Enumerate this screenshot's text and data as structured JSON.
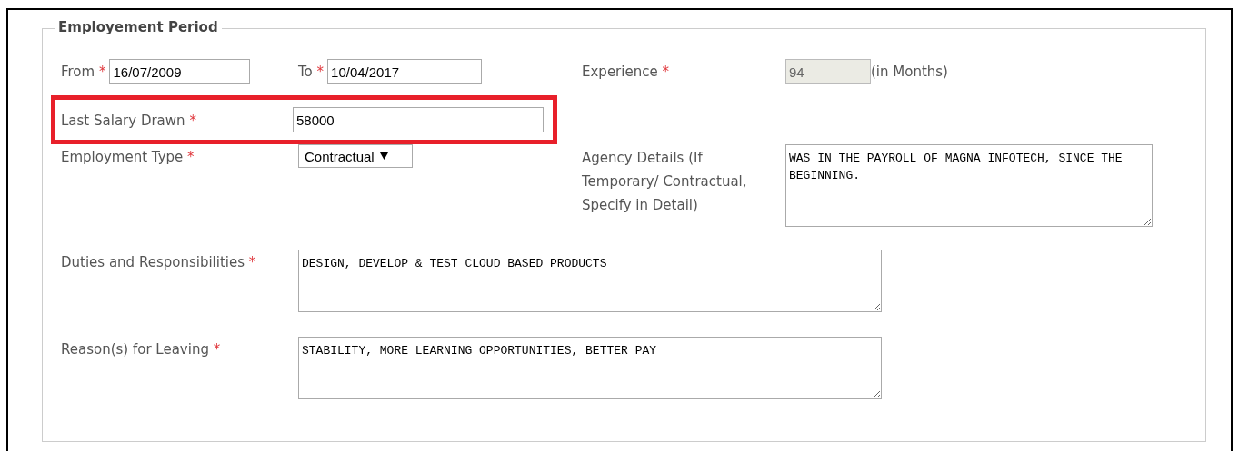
{
  "section": {
    "title": "Employement Period"
  },
  "from": {
    "label": "From",
    "mark": "*",
    "value": "16/07/2009"
  },
  "to": {
    "label": "To",
    "mark": "*",
    "value": "10/04/2017"
  },
  "experience": {
    "label": "Experience",
    "mark": "*",
    "value": "94",
    "disabled": true,
    "unit": "(in Months)"
  },
  "salary": {
    "label": "Last Salary Drawn",
    "mark": "*",
    "value": "58000",
    "highlighted": true
  },
  "employment_type": {
    "label": "Employment Type",
    "mark": "*",
    "value": "Contractual"
  },
  "agency": {
    "label": "Agency Details (If Temporary/ Contractual, Specify in Detail)",
    "value": "WAS IN THE PAYROLL OF MAGNA INFOTECH, SINCE THE BEGINNING."
  },
  "duties": {
    "label": "Duties and Responsibilities",
    "mark": "*",
    "value": "DESIGN, DEVELOP & TEST CLOUD BASED PRODUCTS"
  },
  "reasons": {
    "label": "Reason(s) for Leaving",
    "mark": "*",
    "value": "STABILITY, MORE LEARNING OPPORTUNITIES, BETTER PAY"
  }
}
